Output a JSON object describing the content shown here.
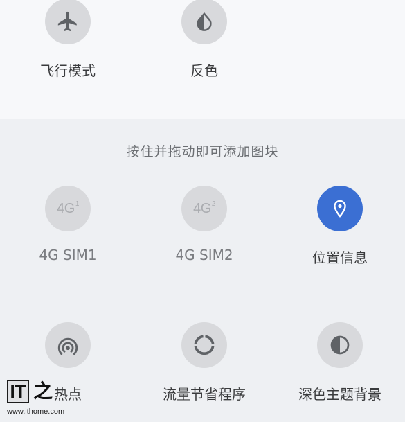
{
  "active_tiles": [
    {
      "label": "飞行模式",
      "icon": "airplane-icon"
    },
    {
      "label": "反色",
      "icon": "invert-colors-icon"
    }
  ],
  "hint": "按住并拖动即可添加图块",
  "available_tiles": [
    {
      "label": "4G SIM1",
      "icon": "4g-sim1-icon",
      "glyph": "4G",
      "sup": "1",
      "state": "disabled"
    },
    {
      "label": "4G SIM2",
      "icon": "4g-sim2-icon",
      "glyph": "4G",
      "sup": "2",
      "state": "disabled"
    },
    {
      "label": "位置信息",
      "icon": "location-pin-icon",
      "state": "active"
    },
    {
      "label": "热点",
      "icon": "hotspot-icon"
    },
    {
      "label": "流量节省程序",
      "icon": "data-saver-icon"
    },
    {
      "label": "深色主题背景",
      "icon": "dark-theme-icon"
    }
  ],
  "watermark": {
    "logo_text": "IT",
    "logo_char": "之",
    "url": "www.ithome.com"
  },
  "colors": {
    "active_tile": "#3b6fd3",
    "inactive_tile": "#d8d9dc",
    "panel_top": "#f7f8fa",
    "panel_bottom": "#eef0f3"
  }
}
